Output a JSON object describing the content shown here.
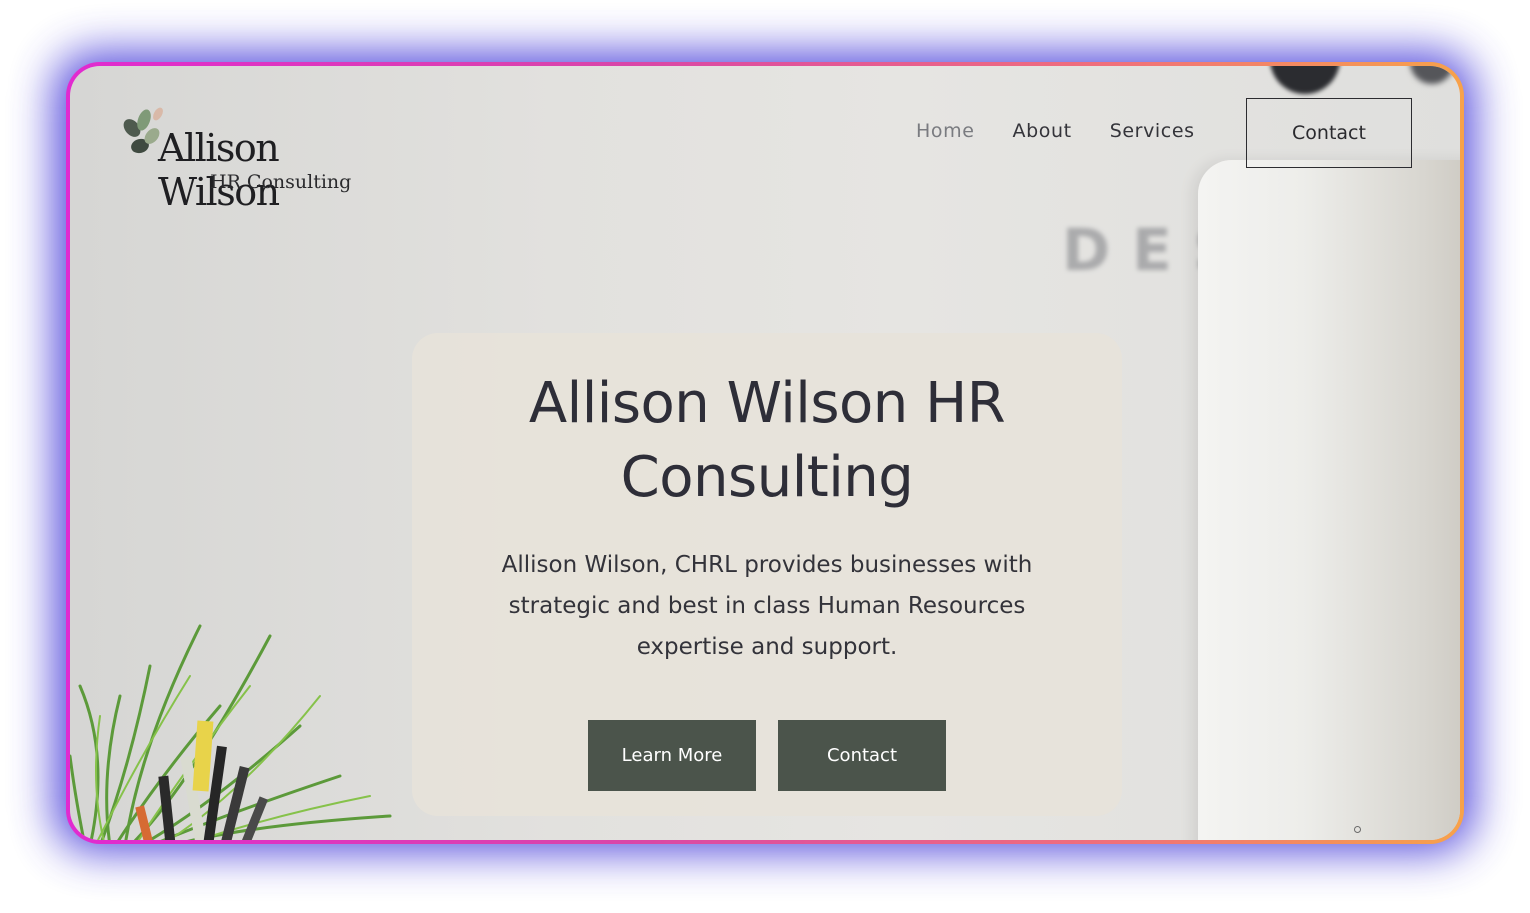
{
  "brand": {
    "name": "Allison Wilson",
    "subtitle": "HR Consulting"
  },
  "nav": {
    "items": [
      {
        "label": "Home",
        "active": true
      },
      {
        "label": "About",
        "active": false
      },
      {
        "label": "Services",
        "active": false
      }
    ],
    "contact_label": "Contact"
  },
  "hero": {
    "title": "Allison Wilson HR Consulting",
    "description": "Allison Wilson, CHRL provides businesses with strategic and best in class Human Resources expertise and support.",
    "learn_more_label": "Learn More",
    "contact_label": "Contact"
  },
  "background": {
    "letters": "DES"
  },
  "colors": {
    "button_bg": "#4b544b",
    "card_bg": "#e7e2d9",
    "frame_gradient_start": "#e12ad0",
    "frame_gradient_end": "#f7a24a",
    "glow": "#3a2fd6"
  }
}
